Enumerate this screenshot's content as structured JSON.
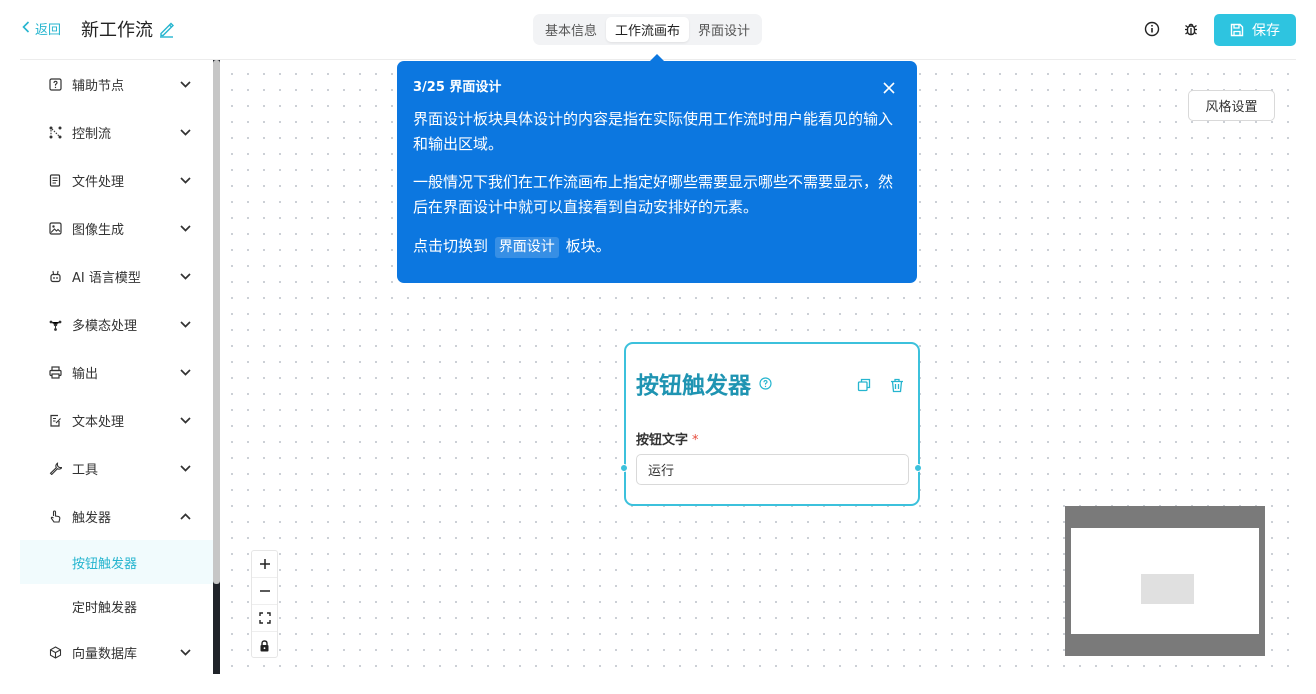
{
  "header": {
    "back_label": "返回",
    "workflow_title": "新工作流",
    "tabs": [
      {
        "label": "基本信息",
        "active": false
      },
      {
        "label": "工作流画布",
        "active": true
      },
      {
        "label": "界面设计",
        "active": false
      }
    ],
    "save_label": "保存",
    "accent_color": "#2ec4e0"
  },
  "sidebar": {
    "items": [
      {
        "label": "辅助节点",
        "icon": "help-square-icon",
        "expanded": false
      },
      {
        "label": "控制流",
        "icon": "flow-icon",
        "expanded": false
      },
      {
        "label": "文件处理",
        "icon": "file-icon",
        "expanded": false
      },
      {
        "label": "图像生成",
        "icon": "image-icon",
        "expanded": false
      },
      {
        "label": "AI 语言模型",
        "icon": "robot-icon",
        "expanded": false
      },
      {
        "label": "多模态处理",
        "icon": "network-icon",
        "expanded": false
      },
      {
        "label": "输出",
        "icon": "printer-icon",
        "expanded": false
      },
      {
        "label": "文本处理",
        "icon": "edit-file-icon",
        "expanded": false
      },
      {
        "label": "工具",
        "icon": "wrench-icon",
        "expanded": false
      },
      {
        "label": "触发器",
        "icon": "pointer-icon",
        "expanded": true
      }
    ],
    "sub_items": [
      {
        "label": "按钮触发器",
        "active": true
      },
      {
        "label": "定时触发器",
        "active": false
      }
    ],
    "last_item": {
      "label": "向量数据库",
      "icon": "cube-icon",
      "expanded": false
    }
  },
  "canvas": {
    "style_button_label": "风格设置"
  },
  "tour": {
    "step": "3/25 界面设计",
    "paragraph1": "界面设计板块具体设计的内容是指在实际使用工作流时用户能看见的输入和输出区域。",
    "paragraph2": "一般情况下我们在工作流画布上指定好哪些需要显示哪些不需要显示，然后在界面设计中就可以直接看到自动安排好的元素。",
    "paragraph3_prefix": "点击切换到",
    "paragraph3_highlight": "界面设计",
    "paragraph3_suffix": "板块。",
    "background_color": "#0c77e0"
  },
  "node": {
    "title": "按钮触发器",
    "field_label": "按钮文字",
    "field_required_mark": "*",
    "field_value": "运行",
    "border_color": "#3cc1dc"
  }
}
